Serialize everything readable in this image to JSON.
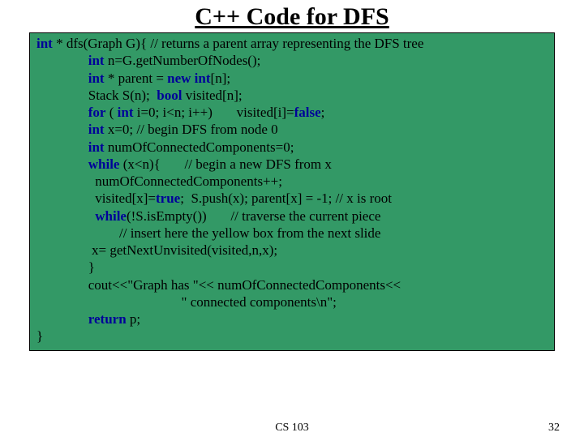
{
  "title": "C++ Code for DFS",
  "code": {
    "l1a": "int",
    "l1b": " * dfs(Graph G){ // returns a parent array representing the DFS tree",
    "l2a": "               int",
    "l2b": " n=G.getNumberOfNodes();",
    "l3a": "               int",
    "l3b": " * parent = ",
    "l3c": "new int",
    "l3d": "[n];",
    "l4a": "               Stack S(n);  ",
    "l4b": "bool",
    "l4c": " visited[n];",
    "l5a": "               for",
    "l5b": " ( ",
    "l5c": "int",
    "l5d": " i=0; i<n; i++)       visited[i]=",
    "l5e": "false",
    "l5f": ";",
    "l6a": "               int",
    "l6b": " x=0; // begin DFS from node 0",
    "l7a": "               int",
    "l7b": " numOfConnectedComponents=0;",
    "l8a": "               while",
    "l8b": " (x<n){       // begin a new DFS from x",
    "l9": "                 numOfConnectedComponents++;",
    "l10a": "                 visited[x]=",
    "l10b": "true",
    "l10c": ";  S.push(x); parent[x] = -1; // x is root",
    "l11a": "                 while",
    "l11b": "(!S.isEmpty())       // traverse the current piece",
    "l12": "                        // insert here the yellow box from the next slide",
    "l13": "                x= getNextUnvisited(visited,n,x);",
    "l14": "               }",
    "l15": "               cout<<\"Graph has \"<< numOfConnectedComponents<<",
    "l16": "                                          \" connected components\\n\";",
    "l17a": "               return",
    "l17b": " p;",
    "l18": "}"
  },
  "footer": {
    "course": "CS 103",
    "page": "32"
  }
}
